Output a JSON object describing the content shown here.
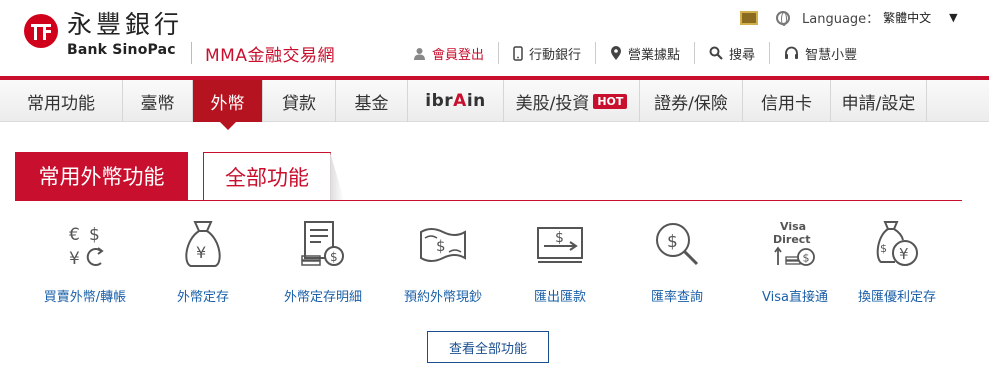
{
  "brand": {
    "name_cn": "永豐銀行",
    "name_en": "Bank SinoPac",
    "site_name": "MMA金融交易網"
  },
  "language": {
    "label": "Language：",
    "value": "繁體中文"
  },
  "topnav": [
    {
      "label": "會員登出",
      "icon": "user-icon"
    },
    {
      "label": "行動銀行",
      "icon": "mobile-icon"
    },
    {
      "label": "營業據點",
      "icon": "location-pin-icon"
    },
    {
      "label": "搜尋",
      "icon": "search-icon"
    },
    {
      "label": "智慧小豐",
      "icon": "headset-icon"
    }
  ],
  "mainnav": [
    {
      "label": "常用功能"
    },
    {
      "label": "臺幣"
    },
    {
      "label": "外幣",
      "active": true
    },
    {
      "label": "貸款"
    },
    {
      "label": "基金"
    },
    {
      "label": "ibrAin"
    },
    {
      "label": "美股/投資",
      "badge": "HOT"
    },
    {
      "label": "證券/保險"
    },
    {
      "label": "信用卡"
    },
    {
      "label": "申請/設定"
    }
  ],
  "function_tabs": {
    "active": "常用外幣功能",
    "inactive": "全部功能"
  },
  "functions": [
    {
      "label": "買賣外幣/轉帳",
      "icon": "currency-exchange-icon"
    },
    {
      "label": "外幣定存",
      "icon": "money-bag-yen-icon"
    },
    {
      "label": "外幣定存明細",
      "icon": "deposit-statement-icon"
    },
    {
      "label": "預約外幣現鈔",
      "icon": "banknote-icon"
    },
    {
      "label": "匯出匯款",
      "icon": "remittance-icon"
    },
    {
      "label": "匯率查詢",
      "icon": "rate-search-icon"
    },
    {
      "label": "Visa直接通",
      "icon": "visa-direct-icon",
      "icon_text": "Visa Direct"
    },
    {
      "label": "換匯優利定存",
      "icon": "exchange-deposit-icon"
    }
  ],
  "view_all": "查看全部功能",
  "colors": {
    "brand_red": "#c8102e",
    "active_tab": "#b5131f",
    "link_blue": "#1a5fa8"
  }
}
